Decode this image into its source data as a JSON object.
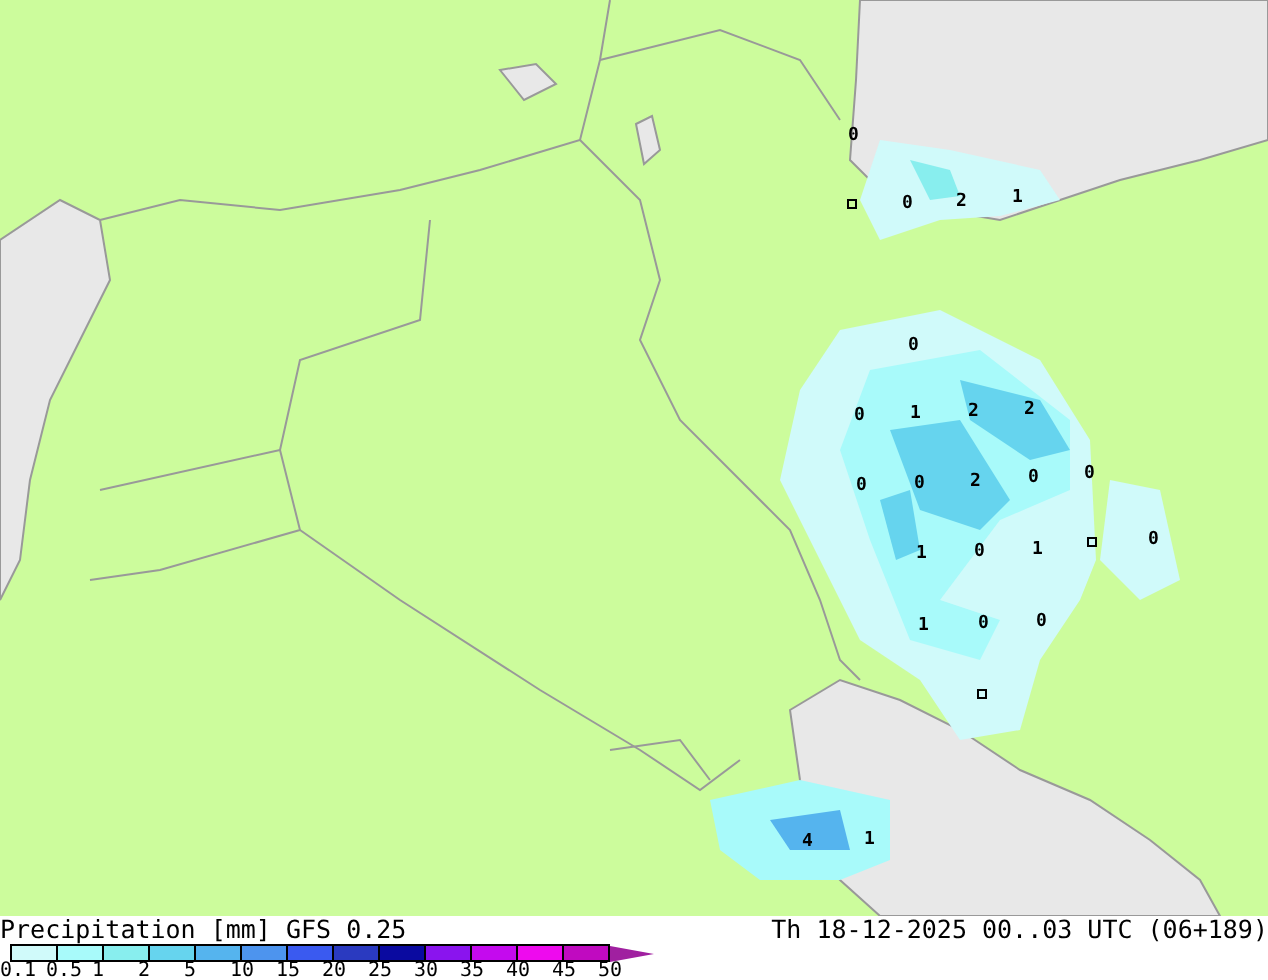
{
  "map": {
    "value_labels": [
      "0",
      "0",
      "2",
      "1",
      "0",
      "0",
      "1",
      "2",
      "2",
      "0",
      "0",
      "2",
      "0",
      "0",
      "1",
      "0",
      "1",
      "0",
      "1",
      "0",
      "0",
      "4",
      "1"
    ]
  },
  "footer": {
    "title": "Precipitation [mm] GFS 0.25",
    "valid_time": "Th 18-12-2025 00..03 UTC (06+189)"
  },
  "legend": {
    "bins": [
      {
        "color": "#d0fafa"
      },
      {
        "color": "#a8fafa"
      },
      {
        "color": "#88eeee"
      },
      {
        "color": "#66d4ee"
      },
      {
        "color": "#55b4ee"
      },
      {
        "color": "#4d94ee"
      },
      {
        "color": "#3a5af0"
      },
      {
        "color": "#2a3ac0"
      },
      {
        "color": "#0a0aa0"
      },
      {
        "color": "#8a14ee"
      },
      {
        "color": "#c40aee"
      },
      {
        "color": "#ee0aee"
      },
      {
        "color": "#c00ac0"
      }
    ],
    "ticks": [
      "0.1",
      "0.5",
      "1",
      "2",
      "5",
      "10",
      "15",
      "20",
      "25",
      "30",
      "35",
      "40",
      "45",
      "50"
    ]
  }
}
